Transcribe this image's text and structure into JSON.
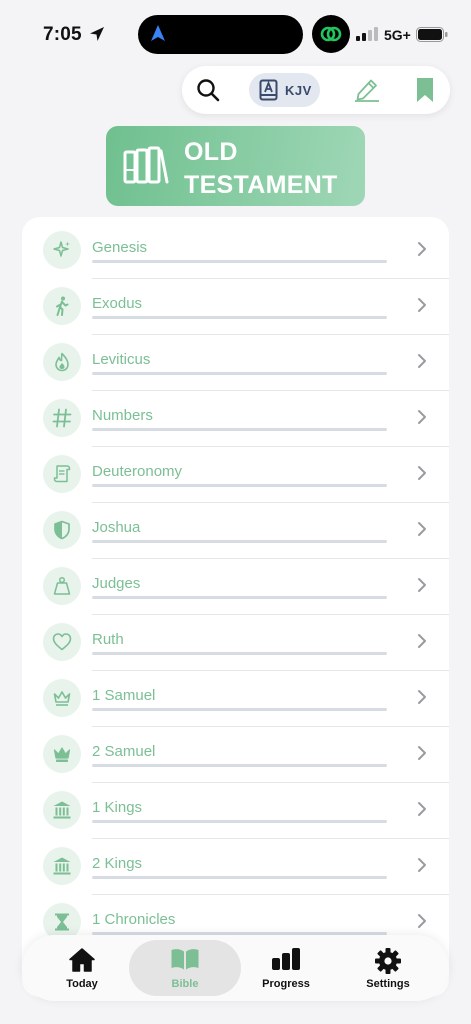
{
  "status_bar": {
    "time": "7:05",
    "network": "5G+"
  },
  "toolbar": {
    "version_label": "KJV"
  },
  "header": {
    "title": "OLD TESTAMENT"
  },
  "books": [
    {
      "name": "Genesis",
      "icon": "sparkles-icon"
    },
    {
      "name": "Exodus",
      "icon": "walking-person-icon"
    },
    {
      "name": "Leviticus",
      "icon": "flame-icon"
    },
    {
      "name": "Numbers",
      "icon": "hash-icon"
    },
    {
      "name": "Deuteronomy",
      "icon": "scroll-icon"
    },
    {
      "name": "Joshua",
      "icon": "shield-icon"
    },
    {
      "name": "Judges",
      "icon": "weight-icon"
    },
    {
      "name": "Ruth",
      "icon": "heart-icon"
    },
    {
      "name": "1 Samuel",
      "icon": "crown-outline-icon"
    },
    {
      "name": "2 Samuel",
      "icon": "crown-filled-icon"
    },
    {
      "name": "1 Kings",
      "icon": "temple-icon"
    },
    {
      "name": "2 Kings",
      "icon": "temple-icon"
    },
    {
      "name": "1 Chronicles",
      "icon": "hourglass-icon"
    }
  ],
  "tabs": [
    {
      "label": "Today",
      "icon": "house-icon",
      "active": false
    },
    {
      "label": "Bible",
      "icon": "open-book-icon",
      "active": true
    },
    {
      "label": "Progress",
      "icon": "bar-chart-icon",
      "active": false
    },
    {
      "label": "Settings",
      "icon": "gear-icon",
      "active": false
    }
  ],
  "colors": {
    "accent": "#7cbf95",
    "banner": "#6fc08f",
    "active_tab": "#7cbf95",
    "background": "#f4f4f6"
  }
}
